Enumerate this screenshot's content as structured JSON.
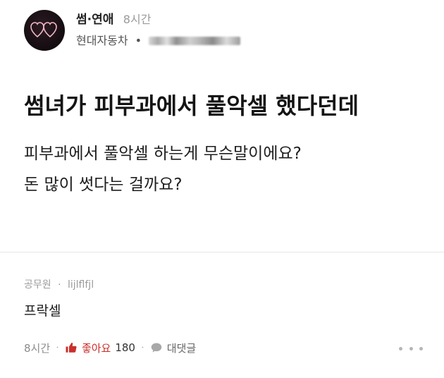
{
  "post": {
    "channel_name": "썸·연애",
    "time_ago": "8시간",
    "author_company": "현대자동차",
    "author_separator": "•",
    "title": "썸녀가 피부과에서 풀악셀 했다던데",
    "body_lines": [
      "피부과에서 풀악셀 하는게 무슨말이에요?",
      "돈 많이 썻다는 걸까요?"
    ],
    "avatar_icon": "double-heart-icon"
  },
  "comment": {
    "author_company": "공무원",
    "separator": "·",
    "author_nick": "lijlflfjl",
    "text": "프락셀",
    "time_ago": "8시간",
    "like_label": "좋아요",
    "like_count": "180",
    "reply_label": "대댓글",
    "like_icon": "thumbs-up-icon",
    "reply_icon": "speech-bubble-icon",
    "more_icon": "more-dots-icon",
    "like_color": "#c9302c"
  }
}
